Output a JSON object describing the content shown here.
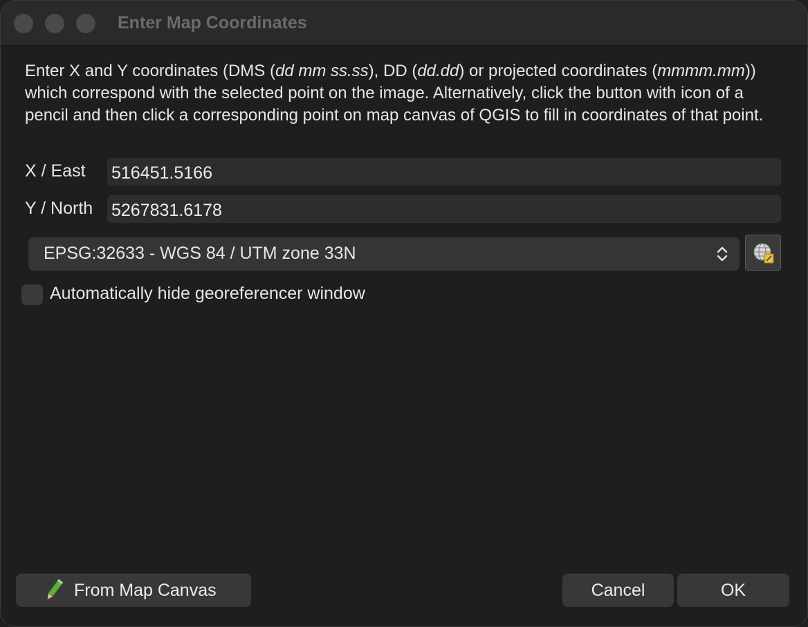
{
  "window": {
    "title": "Enter Map Coordinates"
  },
  "description": {
    "p1": "Enter X and Y coordinates (DMS (",
    "dms_format": "dd mm ss.ss",
    "p2": "), DD (",
    "dd_format": "dd.dd",
    "p3": ") or projected coordinates (",
    "proj_format": "mmmm.mm",
    "p4": ")) which correspond with the selected point on the image. Alternatively, click the button with icon of a pencil and then click a corresponding point on map canvas of QGIS to fill in coordinates of that point."
  },
  "fields": {
    "x_label": "X / East",
    "x_value": "516451.5166",
    "y_label": "Y / North",
    "y_value": "5267831.6178"
  },
  "crs": {
    "selected": "EPSG:32633 - WGS 84 / UTM zone 33N",
    "button_icon": "crs-globe-icon"
  },
  "options": {
    "auto_hide_label": "Automatically hide georeferencer window",
    "auto_hide_checked": false
  },
  "buttons": {
    "from_canvas": "From Map Canvas",
    "from_canvas_icon": "pencil-icon",
    "cancel": "Cancel",
    "ok": "OK"
  },
  "colors": {
    "background": "#1e1e1e",
    "field": "#2d2d2d",
    "button": "#383838",
    "text": "#e6e6e6"
  }
}
